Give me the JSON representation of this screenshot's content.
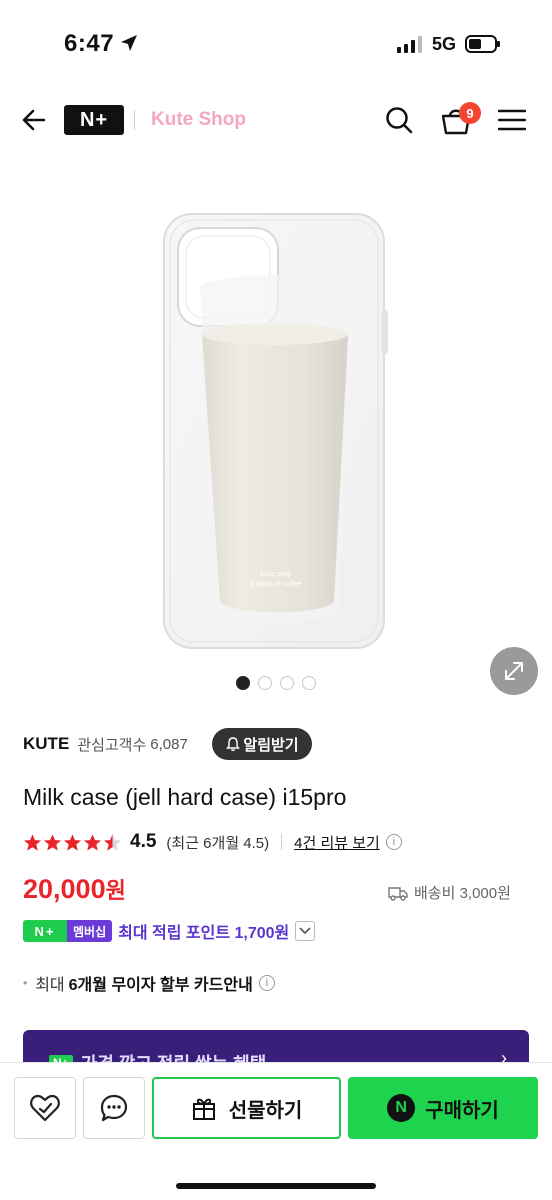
{
  "status_bar": {
    "time": "6:47",
    "network": "5G"
  },
  "header": {
    "logo_text": "N+",
    "shop_name": "Kute Shop",
    "cart_count": "9"
  },
  "product": {
    "image_caption_line1": "Kute shop",
    "image_caption_line2": "a glass of coffee",
    "carousel": {
      "total": 4,
      "active": 1
    },
    "brand": "KUTE",
    "followers_label": "관심고객수",
    "followers_count": "6,087",
    "alert_label": "알림받기",
    "title": "Milk case (jell hard case) i15pro",
    "rating": {
      "stars": 4.5,
      "value": "4.5",
      "recent": "(최근 6개월 4.5)",
      "review_link": "4건 리뷰 보기"
    },
    "price": "20,000",
    "price_unit": "원",
    "shipping": "배송비 3,000원"
  },
  "points": {
    "chip_n": "N+",
    "chip_member": "멤버십",
    "text": "최대 적립 포인트 1,700원"
  },
  "installment": {
    "prefix": "최대",
    "strong": "6개월 무이자 할부 카드안내"
  },
  "promo": {
    "chip": "N+",
    "text": "가격 깎고 적립 쌓는 혜택"
  },
  "bottom_bar": {
    "gift_label": "선물하기",
    "buy_label": "구매하기",
    "npay_letter": "N"
  },
  "colors": {
    "price_red": "#e8262a",
    "naver_green": "#1ed44f",
    "membership_purple": "#5b34d0",
    "shop_pink": "#f4a6c4",
    "badge_red": "#f5442f"
  }
}
